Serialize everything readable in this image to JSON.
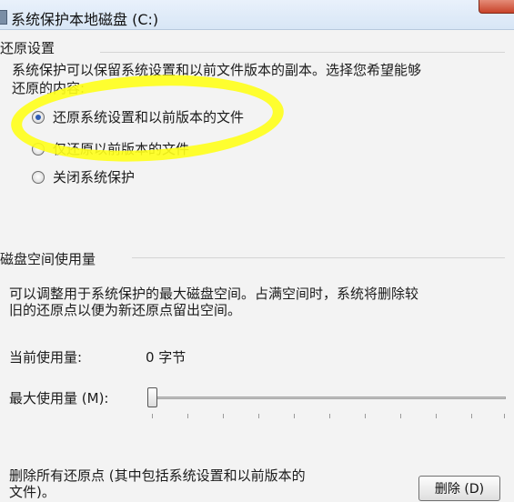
{
  "window": {
    "title": "系统保护本地磁盘 (C:)"
  },
  "restore_settings": {
    "heading": "还原设置",
    "description_line1": "系统保护可以保留系统设置和以前文件版本的副本。选择您希望能够",
    "description_line2": "还原的内容:",
    "options": [
      {
        "label": "还原系统设置和以前版本的文件",
        "selected": true
      },
      {
        "label": "仅还原以前版本的文件",
        "selected": false
      },
      {
        "label": "关闭系统保护",
        "selected": false
      }
    ]
  },
  "disk_usage": {
    "heading": "磁盘空间使用量",
    "description_line1": "可以调整用于系统保护的最大磁盘空间。占满空间时，系统将删除较",
    "description_line2": "旧的还原点以便为新还原点留出空间。",
    "current_label": "当前使用量:",
    "current_value": "0 字节",
    "max_label": "最大使用量 (M):",
    "max_value_fraction": 0.0
  },
  "delete": {
    "description_line1": "删除所有还原点 (其中包括系统设置和以前版本的",
    "description_line2": "文件)。",
    "button_label": "删除 (D)"
  },
  "annotation": {
    "color": "#ffff19"
  }
}
